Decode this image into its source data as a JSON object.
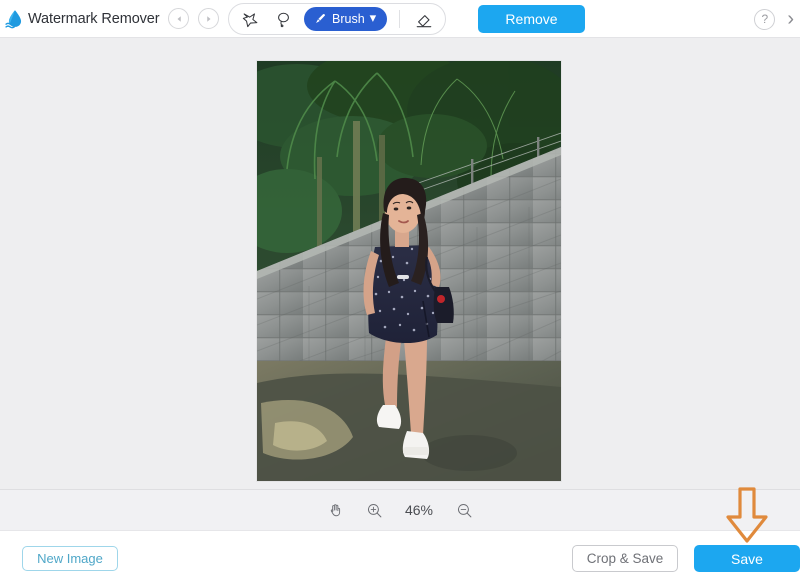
{
  "app": {
    "title": "Watermark Remover",
    "logo_icon": "water-droplet-logo",
    "accent_blue": "#1ca7f0",
    "brush_blue": "#2a5fd1",
    "annotation_orange": "#e08a3c",
    "canvas_bg": "#eeeef0"
  },
  "topbar": {
    "undo_icon": "undo-icon",
    "redo_icon": "redo-icon",
    "tools": [
      {
        "name": "polygon-lasso-tool",
        "icon": "polygon-lasso-icon",
        "label": "Polygonal Lasso",
        "active": false
      },
      {
        "name": "free-lasso-tool",
        "icon": "lasso-icon",
        "label": "Lasso",
        "active": false
      },
      {
        "name": "brush-tool",
        "icon": "brush-icon",
        "label": "Brush",
        "active": true,
        "chevron": "⌄"
      },
      {
        "name": "eraser-tool",
        "icon": "eraser-icon",
        "label": "Eraser",
        "active": false
      }
    ],
    "remove_label": "Remove",
    "help_label": "?",
    "next_chevron": "›"
  },
  "canvas": {
    "photo_alt": "Woman in dark floral dress standing by a concrete block wall with palm trees"
  },
  "zoombar": {
    "hand_icon": "hand-tool-icon",
    "zoom_in_icon": "zoom-in-icon",
    "zoom_out_icon": "zoom-out-icon",
    "zoom_level": "46%"
  },
  "footer": {
    "new_image_label": "New Image",
    "crop_save_label": "Crop & Save",
    "save_label": "Save"
  },
  "annotation": {
    "arrow_icon": "down-arrow-annotation",
    "points_to": "save-button"
  }
}
